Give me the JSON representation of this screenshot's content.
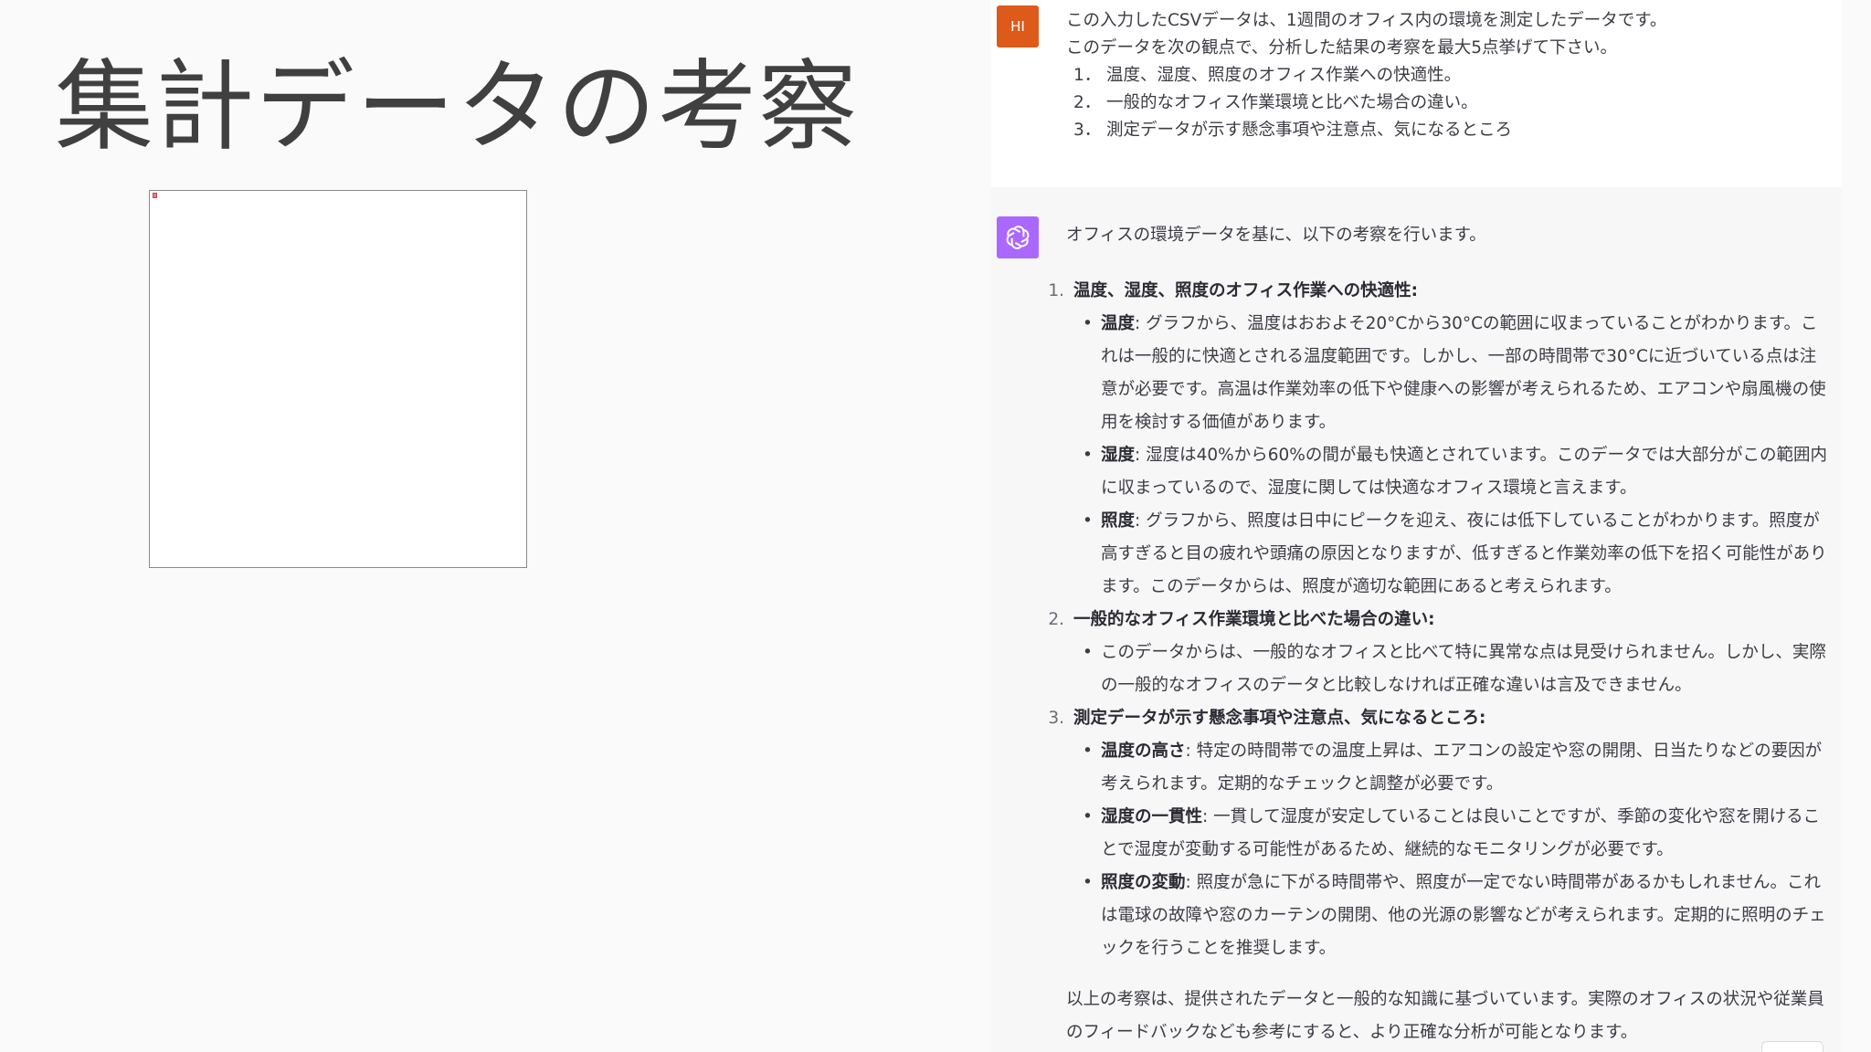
{
  "slide": {
    "title": "集計データの考察"
  },
  "chat": {
    "user": {
      "avatar_text": "HI",
      "lines": [
        "この入力したCSVデータは、1週間のオフィス内の環境を測定したデータです。",
        "このデータを次の観点で、分析した結果の考察を最大5点挙げて下さい。"
      ],
      "items": [
        {
          "num": "1．",
          "text": "温度、湿度、照度のオフィス作業への快適性。"
        },
        {
          "num": "2．",
          "text": "一般的なオフィス作業環境と比べた場合の違い。"
        },
        {
          "num": "3．",
          "text": "測定データが示す懸念事項や注意点、気になるところ"
        }
      ]
    },
    "assistant": {
      "intro": "オフィスの環境データを基に、以下の考察を行います。",
      "sections": [
        {
          "num": "1.",
          "title": "温度、湿度、照度のオフィス作業への快適性:",
          "bullets": [
            {
              "label": "温度",
              "text": ": グラフから、温度はおおよそ20°Cから30°Cの範囲に収まっていることがわかります。これは一般的に快適とされる温度範囲です。しかし、一部の時間帯で30°Cに近づいている点は注意が必要です。高温は作業効率の低下や健康への影響が考えられるため、エアコンや扇風機の使用を検討する価値があります。"
            },
            {
              "label": "湿度",
              "text": ": 湿度は40%から60%の間が最も快適とされています。このデータでは大部分がこの範囲内に収まっているので、湿度に関しては快適なオフィス環境と言えます。"
            },
            {
              "label": "照度",
              "text": ": グラフから、照度は日中にピークを迎え、夜には低下していることがわかります。照度が高すぎると目の疲れや頭痛の原因となりますが、低すぎると作業効率の低下を招く可能性があります。このデータからは、照度が適切な範囲にあると考えられます。"
            }
          ]
        },
        {
          "num": "2.",
          "title": "一般的なオフィス作業環境と比べた場合の違い:",
          "bullets": [
            {
              "label": "",
              "text": "このデータからは、一般的なオフィスと比べて特に異常な点は見受けられません。しかし、実際の一般的なオフィスのデータと比較しなければ正確な違いは言及できません。"
            }
          ]
        },
        {
          "num": "3.",
          "title": "測定データが示す懸念事項や注意点、気になるところ:",
          "bullets": [
            {
              "label": "温度の高さ",
              "text": ": 特定の時間帯での温度上昇は、エアコンの設定や窓の開閉、日当たりなどの要因が考えられます。定期的なチェックと調整が必要です。"
            },
            {
              "label": "湿度の一貫性",
              "text": ": 一貫して湿度が安定していることは良いことですが、季節の変化や窓を開けることで湿度が変動する可能性があるため、継続的なモニタリングが必要です。"
            },
            {
              "label": "照度の変動",
              "text": ": 照度が急に下がる時間帯や、照度が一定でない時間帯があるかもしれません。これは電球の故障や窓のカーテンの開閉、他の光源の影響などが考えられます。定期的に照明のチェックを行うことを推奨します。"
            }
          ]
        }
      ],
      "outro": "以上の考察は、提供されたデータと一般的な知識に基づいています。実際のオフィスの状況や従業員のフィードバックなども参考にすると、より正確な分析が可能となります。"
    }
  },
  "colors": {
    "user_avatar": "#dd5a1a",
    "assistant_avatar": "#ab68ff",
    "assistant_bg": "#f7f7f8"
  }
}
